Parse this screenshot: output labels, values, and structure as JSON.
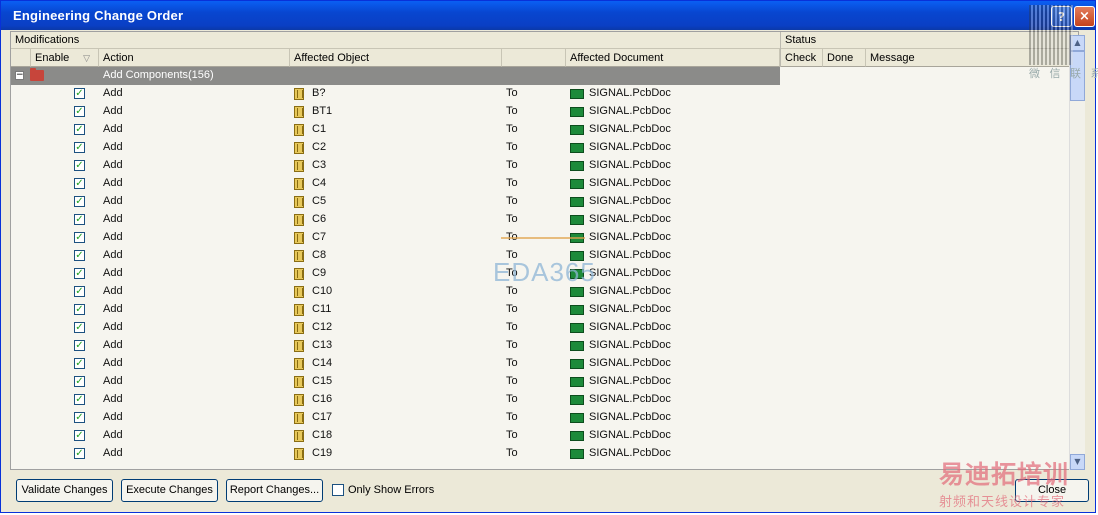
{
  "window": {
    "title": "Engineering Change Order"
  },
  "titlebar": {
    "help_label": "?",
    "close_label": "×"
  },
  "watermark_qr": {
    "text": "微 信 联 系"
  },
  "groups": {
    "modifications": "Modifications",
    "status": "Status"
  },
  "columns": {
    "enable": "Enable",
    "action": "Action",
    "affected_object": "Affected Object",
    "affected_document": "Affected Document",
    "check": "Check",
    "done": "Done",
    "message": "Message"
  },
  "group_row": {
    "label": "Add Components(156)",
    "expander": "−"
  },
  "rows": [
    {
      "enabled": true,
      "action": "Add",
      "object": "B?",
      "to": "To",
      "document": "SIGNAL.PcbDoc"
    },
    {
      "enabled": true,
      "action": "Add",
      "object": "BT1",
      "to": "To",
      "document": "SIGNAL.PcbDoc"
    },
    {
      "enabled": true,
      "action": "Add",
      "object": "C1",
      "to": "To",
      "document": "SIGNAL.PcbDoc"
    },
    {
      "enabled": true,
      "action": "Add",
      "object": "C2",
      "to": "To",
      "document": "SIGNAL.PcbDoc"
    },
    {
      "enabled": true,
      "action": "Add",
      "object": "C3",
      "to": "To",
      "document": "SIGNAL.PcbDoc"
    },
    {
      "enabled": true,
      "action": "Add",
      "object": "C4",
      "to": "To",
      "document": "SIGNAL.PcbDoc"
    },
    {
      "enabled": true,
      "action": "Add",
      "object": "C5",
      "to": "To",
      "document": "SIGNAL.PcbDoc"
    },
    {
      "enabled": true,
      "action": "Add",
      "object": "C6",
      "to": "To",
      "document": "SIGNAL.PcbDoc"
    },
    {
      "enabled": true,
      "action": "Add",
      "object": "C7",
      "to": "To",
      "document": "SIGNAL.PcbDoc"
    },
    {
      "enabled": true,
      "action": "Add",
      "object": "C8",
      "to": "To",
      "document": "SIGNAL.PcbDoc"
    },
    {
      "enabled": true,
      "action": "Add",
      "object": "C9",
      "to": "To",
      "document": "SIGNAL.PcbDoc"
    },
    {
      "enabled": true,
      "action": "Add",
      "object": "C10",
      "to": "To",
      "document": "SIGNAL.PcbDoc"
    },
    {
      "enabled": true,
      "action": "Add",
      "object": "C11",
      "to": "To",
      "document": "SIGNAL.PcbDoc"
    },
    {
      "enabled": true,
      "action": "Add",
      "object": "C12",
      "to": "To",
      "document": "SIGNAL.PcbDoc"
    },
    {
      "enabled": true,
      "action": "Add",
      "object": "C13",
      "to": "To",
      "document": "SIGNAL.PcbDoc"
    },
    {
      "enabled": true,
      "action": "Add",
      "object": "C14",
      "to": "To",
      "document": "SIGNAL.PcbDoc"
    },
    {
      "enabled": true,
      "action": "Add",
      "object": "C15",
      "to": "To",
      "document": "SIGNAL.PcbDoc"
    },
    {
      "enabled": true,
      "action": "Add",
      "object": "C16",
      "to": "To",
      "document": "SIGNAL.PcbDoc"
    },
    {
      "enabled": true,
      "action": "Add",
      "object": "C17",
      "to": "To",
      "document": "SIGNAL.PcbDoc"
    },
    {
      "enabled": true,
      "action": "Add",
      "object": "C18",
      "to": "To",
      "document": "SIGNAL.PcbDoc"
    },
    {
      "enabled": true,
      "action": "Add",
      "object": "C19",
      "to": "To",
      "document": "SIGNAL.PcbDoc"
    }
  ],
  "checkmark": "✓",
  "buttons": {
    "validate": "Validate Changes",
    "execute": "Execute Changes",
    "report": "Report Changes...",
    "close": "Close"
  },
  "only_show_errors": "Only Show Errors",
  "watermark_eda": "EDA365",
  "watermark_cn": {
    "line1": "易迪拓培训",
    "line2": "射频和天线设计专家"
  }
}
